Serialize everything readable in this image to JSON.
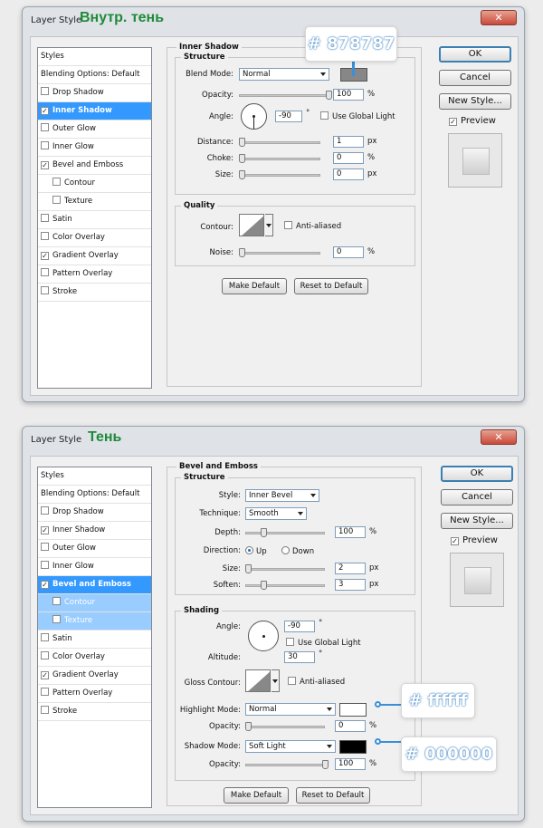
{
  "dialog1": {
    "title": "Layer Style",
    "title_extra": "Внутр. тень",
    "close_glyph": "✕",
    "styles_header": "Styles",
    "blending_options": "Blending Options: Default",
    "style_items": [
      {
        "label": "Drop Shadow",
        "checked": false
      },
      {
        "label": "Inner Shadow",
        "checked": true
      },
      {
        "label": "Outer Glow",
        "checked": false
      },
      {
        "label": "Inner Glow",
        "checked": false
      },
      {
        "label": "Bevel and Emboss",
        "checked": true
      },
      {
        "label": "Contour",
        "checked": false
      },
      {
        "label": "Texture",
        "checked": false
      },
      {
        "label": "Satin",
        "checked": false
      },
      {
        "label": "Color Overlay",
        "checked": false
      },
      {
        "label": "Gradient Overlay",
        "checked": true
      },
      {
        "label": "Pattern Overlay",
        "checked": false
      },
      {
        "label": "Stroke",
        "checked": false
      }
    ],
    "section_title": "Inner Shadow",
    "structure_title": "Structure",
    "blend_mode_label": "Blend Mode:",
    "blend_mode_value": "Normal",
    "blend_color": "#878787",
    "opacity_label": "Opacity:",
    "opacity_value": "100",
    "angle_label": "Angle:",
    "angle_value": "-90",
    "degree": "°",
    "global_light_label": "Use Global Light",
    "distance_label": "Distance:",
    "distance_value": "1",
    "choke_label": "Choke:",
    "choke_value": "0",
    "size_label": "Size:",
    "size_value": "0",
    "px": "px",
    "pct": "%",
    "quality_title": "Quality",
    "contour_label": "Contour:",
    "anti_aliased_label": "Anti-aliased",
    "noise_label": "Noise:",
    "noise_value": "0",
    "make_default": "Make Default",
    "reset_default": "Reset to Default",
    "ok": "OK",
    "cancel": "Cancel",
    "new_style": "New Style...",
    "preview": "Preview",
    "callout_color": "# 878787"
  },
  "dialog2": {
    "title": "Layer Style",
    "title_extra": "Тень",
    "close_glyph": "✕",
    "styles_header": "Styles",
    "blending_options": "Blending Options: Default",
    "style_items": [
      {
        "label": "Drop Shadow",
        "checked": false
      },
      {
        "label": "Inner Shadow",
        "checked": true
      },
      {
        "label": "Outer Glow",
        "checked": false
      },
      {
        "label": "Inner Glow",
        "checked": false
      },
      {
        "label": "Bevel and Emboss",
        "checked": true
      },
      {
        "label": "Contour",
        "checked": false
      },
      {
        "label": "Texture",
        "checked": false
      },
      {
        "label": "Satin",
        "checked": false
      },
      {
        "label": "Color Overlay",
        "checked": false
      },
      {
        "label": "Gradient Overlay",
        "checked": true
      },
      {
        "label": "Pattern Overlay",
        "checked": false
      },
      {
        "label": "Stroke",
        "checked": false
      }
    ],
    "section_title": "Bevel and Emboss",
    "structure_title": "Structure",
    "style_label": "Style:",
    "style_value": "Inner Bevel",
    "technique_label": "Technique:",
    "technique_value": "Smooth",
    "depth_label": "Depth:",
    "depth_value": "100",
    "direction_label": "Direction:",
    "direction_up": "Up",
    "direction_down": "Down",
    "size_label": "Size:",
    "size_value": "2",
    "soften_label": "Soften:",
    "soften_value": "3",
    "px": "px",
    "pct": "%",
    "degree": "°",
    "shading_title": "Shading",
    "angle_label": "Angle:",
    "angle_value": "-90",
    "global_light_label": "Use Global Light",
    "altitude_label": "Altitude:",
    "altitude_value": "30",
    "gloss_contour_label": "Gloss Contour:",
    "anti_aliased_label": "Anti-aliased",
    "highlight_mode_label": "Highlight Mode:",
    "highlight_mode_value": "Normal",
    "highlight_color": "#ffffff",
    "highlight_opacity_label": "Opacity:",
    "highlight_opacity_value": "0",
    "shadow_mode_label": "Shadow Mode:",
    "shadow_mode_value": "Soft Light",
    "shadow_color": "#000000",
    "shadow_opacity_label": "Opacity:",
    "shadow_opacity_value": "100",
    "make_default": "Make Default",
    "reset_default": "Reset to Default",
    "ok": "OK",
    "cancel": "Cancel",
    "new_style": "New Style...",
    "preview": "Preview",
    "callout_highlight": "# ffffff",
    "callout_shadow": "# 000000"
  },
  "check_glyph": "✓"
}
